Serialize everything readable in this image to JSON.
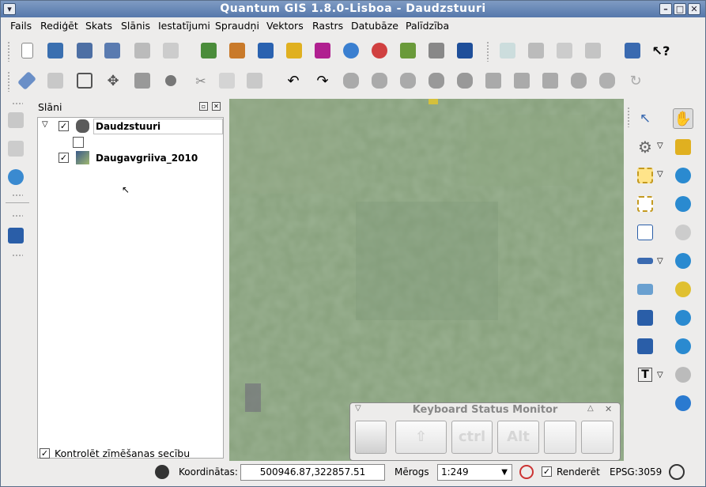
{
  "window": {
    "title": "Quantum GIS 1.8.0-Lisboa - Daudzstuuri"
  },
  "menu": [
    "Fails",
    "Rediģēt",
    "Skats",
    "Slānis",
    "Iestatījumi",
    "Spraudņi",
    "Vektors",
    "Rastrs",
    "Datubāze",
    "Palīdzība"
  ],
  "layers_panel": {
    "title": "Slāni",
    "layers": [
      {
        "name": "Daudzstuuri",
        "checked": true,
        "type": "vector-group"
      },
      {
        "name": "Daugavgriiva_2010",
        "checked": true,
        "type": "raster"
      }
    ],
    "draw_order_label": "Kontrolēt zīmēšanas secību"
  },
  "keyboard_monitor": {
    "title": "Keyboard Status Monitor",
    "keys": [
      "ctrl",
      "Alt"
    ]
  },
  "statusbar": {
    "coordinates_label": "Koordinātas:",
    "coordinates_value": "500946.87,322857.51",
    "scale_label": "Mērogs",
    "scale_value": "1:249",
    "render_label": "Renderēt",
    "crs": "EPSG:3059"
  },
  "colors": {
    "titlebar": "#5678ab",
    "map_base": "#87a07c"
  }
}
